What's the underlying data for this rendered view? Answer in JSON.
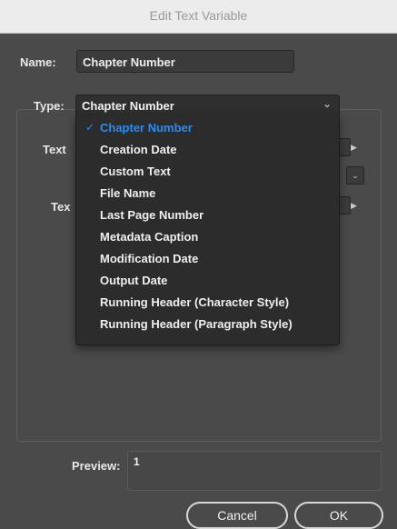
{
  "window": {
    "title": "Edit Text Variable"
  },
  "name_field": {
    "label": "Name:",
    "value": "Chapter Number"
  },
  "type_field": {
    "label": "Type:",
    "selected": "Chapter Number",
    "options": [
      "Chapter Number",
      "Creation Date",
      "Custom Text",
      "File Name",
      "Last Page Number",
      "Metadata Caption",
      "Modification Date",
      "Output Date",
      "Running Header (Character Style)",
      "Running Header (Paragraph Style)"
    ]
  },
  "options": {
    "text_before_label": "Text",
    "text_after_label": "Tex"
  },
  "preview": {
    "label": "Preview:",
    "value": "1"
  },
  "buttons": {
    "cancel": "Cancel",
    "ok": "OK"
  },
  "icons": {
    "checkmark": "checkmark-icon",
    "chevron": "chevron-down-icon",
    "arrow": "triangle-right-icon"
  },
  "colors": {
    "selected_item": "#2d8ceb",
    "dialog_bg": "#4a4a4a",
    "menu_bg": "#2c2c2c"
  }
}
